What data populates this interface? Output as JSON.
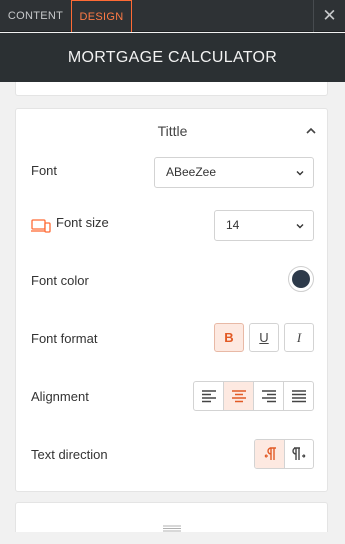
{
  "tabs": [
    {
      "label": "CONTENT",
      "active": false
    },
    {
      "label": "DESIGN",
      "active": true
    }
  ],
  "header": {
    "title": "MORTGAGE CALCULATOR"
  },
  "section": {
    "title": "Tittle",
    "font": {
      "label": "Font",
      "value": "ABeeZee"
    },
    "font_size": {
      "label": "Font size",
      "value": "14"
    },
    "font_color": {
      "label": "Font color",
      "color": "#2d3a4a"
    },
    "font_format": {
      "label": "Font format",
      "bold": true,
      "underline": false,
      "italic": false,
      "bold_glyph": "B",
      "underline_glyph": "U",
      "italic_glyph": "I"
    },
    "alignment": {
      "label": "Alignment",
      "selected": "center",
      "options": [
        "left",
        "center",
        "right",
        "justify"
      ]
    },
    "text_direction": {
      "label": "Text direction",
      "selected": "ltr",
      "options": [
        "ltr",
        "rtl"
      ]
    }
  },
  "colors": {
    "accent": "#ff6b35",
    "header_bg": "#2b3033",
    "topbar_bg": "#2e3235"
  }
}
